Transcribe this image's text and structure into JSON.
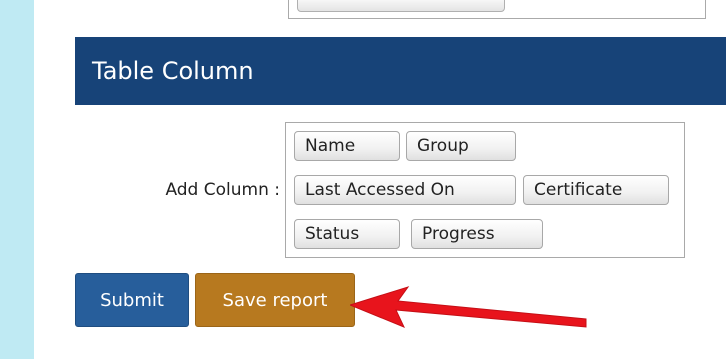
{
  "section": {
    "title": "Table Column"
  },
  "add_column": {
    "label": "Add Column :",
    "columns": [
      "Name",
      "Group",
      "Last Accessed On",
      "Certificate",
      "Status",
      "Progress"
    ]
  },
  "actions": {
    "submit_label": "Submit",
    "save_label": "Save report"
  },
  "colors": {
    "header_bg": "#174378",
    "submit_bg": "#275e9b",
    "save_bg": "#b7791f",
    "left_strip": "#bfeaf3",
    "annotation_arrow": "#e8141c"
  }
}
